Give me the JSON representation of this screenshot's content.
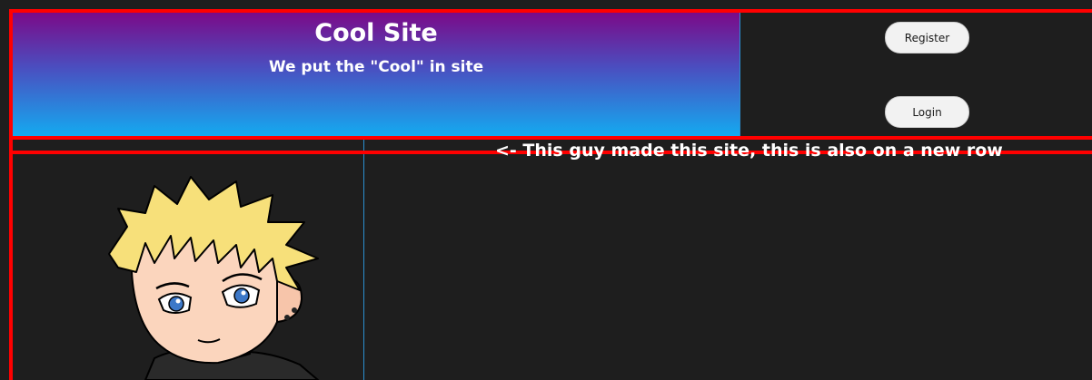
{
  "header": {
    "title": "Cool Site",
    "subtitle": "We put the \"Cool\" in site"
  },
  "auth": {
    "register_label": "Register",
    "login_label": "Login"
  },
  "content": {
    "caption": "<- This guy made this site, this is also on a new row"
  },
  "colors": {
    "gradient_top": "#7b0a88",
    "gradient_bottom": "#14aaf0",
    "outline": "#ff0000",
    "background": "#1e1e1e",
    "divider": "#2b8fd0"
  },
  "avatar": {
    "description_icon": "anime-portrait-icon"
  }
}
